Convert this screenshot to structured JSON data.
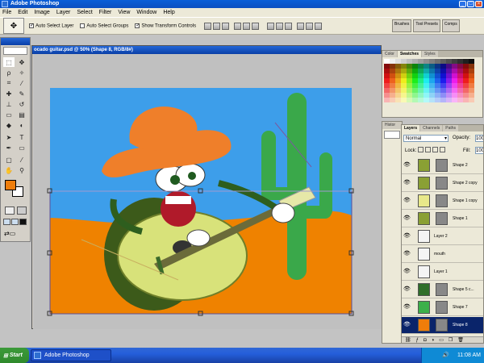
{
  "app": {
    "title": "Adobe Photoshop"
  },
  "menu": [
    "File",
    "Edit",
    "Image",
    "Layer",
    "Select",
    "Filter",
    "View",
    "Window",
    "Help"
  ],
  "options": {
    "auto_select_layer": "Auto Select Layer",
    "auto_select_groups": "Auto Select Groups",
    "show_transform_controls": "Show Transform Controls",
    "auto_select_layer_checked": true,
    "auto_select_groups_checked": false,
    "show_transform_checked": true
  },
  "panel_well": {
    "tabs": [
      "Brushes",
      "Tool Presets",
      "Comps"
    ]
  },
  "document": {
    "title": "ocado guitar.psd @ 50% (Shape 8, RGB/8#)"
  },
  "swatches_panel": {
    "tabs": [
      "Color",
      "Swatches",
      "Styles"
    ],
    "active": "Swatches"
  },
  "history_tab": "Histor",
  "layers_panel": {
    "tabs": [
      "Layers",
      "Channels",
      "Paths"
    ],
    "blend_mode": "Normal",
    "opacity_label": "Opacity:",
    "opacity_value": "100",
    "lock_label": "Lock:",
    "fill_label": "Fill:",
    "fill_value": "100",
    "layers": [
      {
        "name": "Shape 2",
        "color": "#8aa034",
        "mask": true,
        "selected": false
      },
      {
        "name": "Shape 2 copy",
        "color": "#8aa034",
        "mask": true,
        "selected": false
      },
      {
        "name": "Shape 1 copy",
        "color": "#e8e88a",
        "mask": true,
        "selected": false
      },
      {
        "name": "Shape 1",
        "color": "#8aa034",
        "mask": true,
        "selected": false
      },
      {
        "name": "Layer 2",
        "color": "#f4f4f4",
        "mask": false,
        "selected": false
      },
      {
        "name": "mouth",
        "color": "#f4f4f4",
        "mask": false,
        "selected": false
      },
      {
        "name": "Layer 1",
        "color": "#f4f4f4",
        "mask": false,
        "selected": false
      },
      {
        "name": "Shape 5 c...",
        "color": "#2f6e2a",
        "mask": true,
        "selected": false
      },
      {
        "name": "Shape 7",
        "color": "#3cb04a",
        "mask": true,
        "selected": false
      },
      {
        "name": "Shape 8",
        "color": "#ef7d0a",
        "mask": true,
        "selected": true
      }
    ]
  },
  "toolbox": {
    "foreground_color": "#ef7d0a",
    "background_color": "#ffffff",
    "tool_icons": [
      "move-icon",
      "marquee-icon",
      "lasso-icon",
      "magic-wand-icon",
      "crop-icon",
      "slice-icon",
      "healing-icon",
      "brush-icon",
      "stamp-icon",
      "history-brush-icon",
      "eraser-icon",
      "gradient-icon",
      "blur-icon",
      "dodge-icon",
      "path-select-icon",
      "type-icon",
      "pen-icon",
      "shape-icon",
      "notes-icon",
      "eyedropper-icon",
      "hand-icon",
      "zoom-icon"
    ]
  },
  "artwork": {
    "sky_color": "#3d9eea",
    "ground_color": "#ef8200",
    "cactus_color": "#3aa84a",
    "avocado_dark": "#3c5a1a",
    "avocado_flesh": "#d8e27a",
    "hat_color": "#ef7f2a"
  },
  "taskbar": {
    "start_label": "Start",
    "task_label": "Adobe Photoshop",
    "clock": "11:08 AM"
  }
}
